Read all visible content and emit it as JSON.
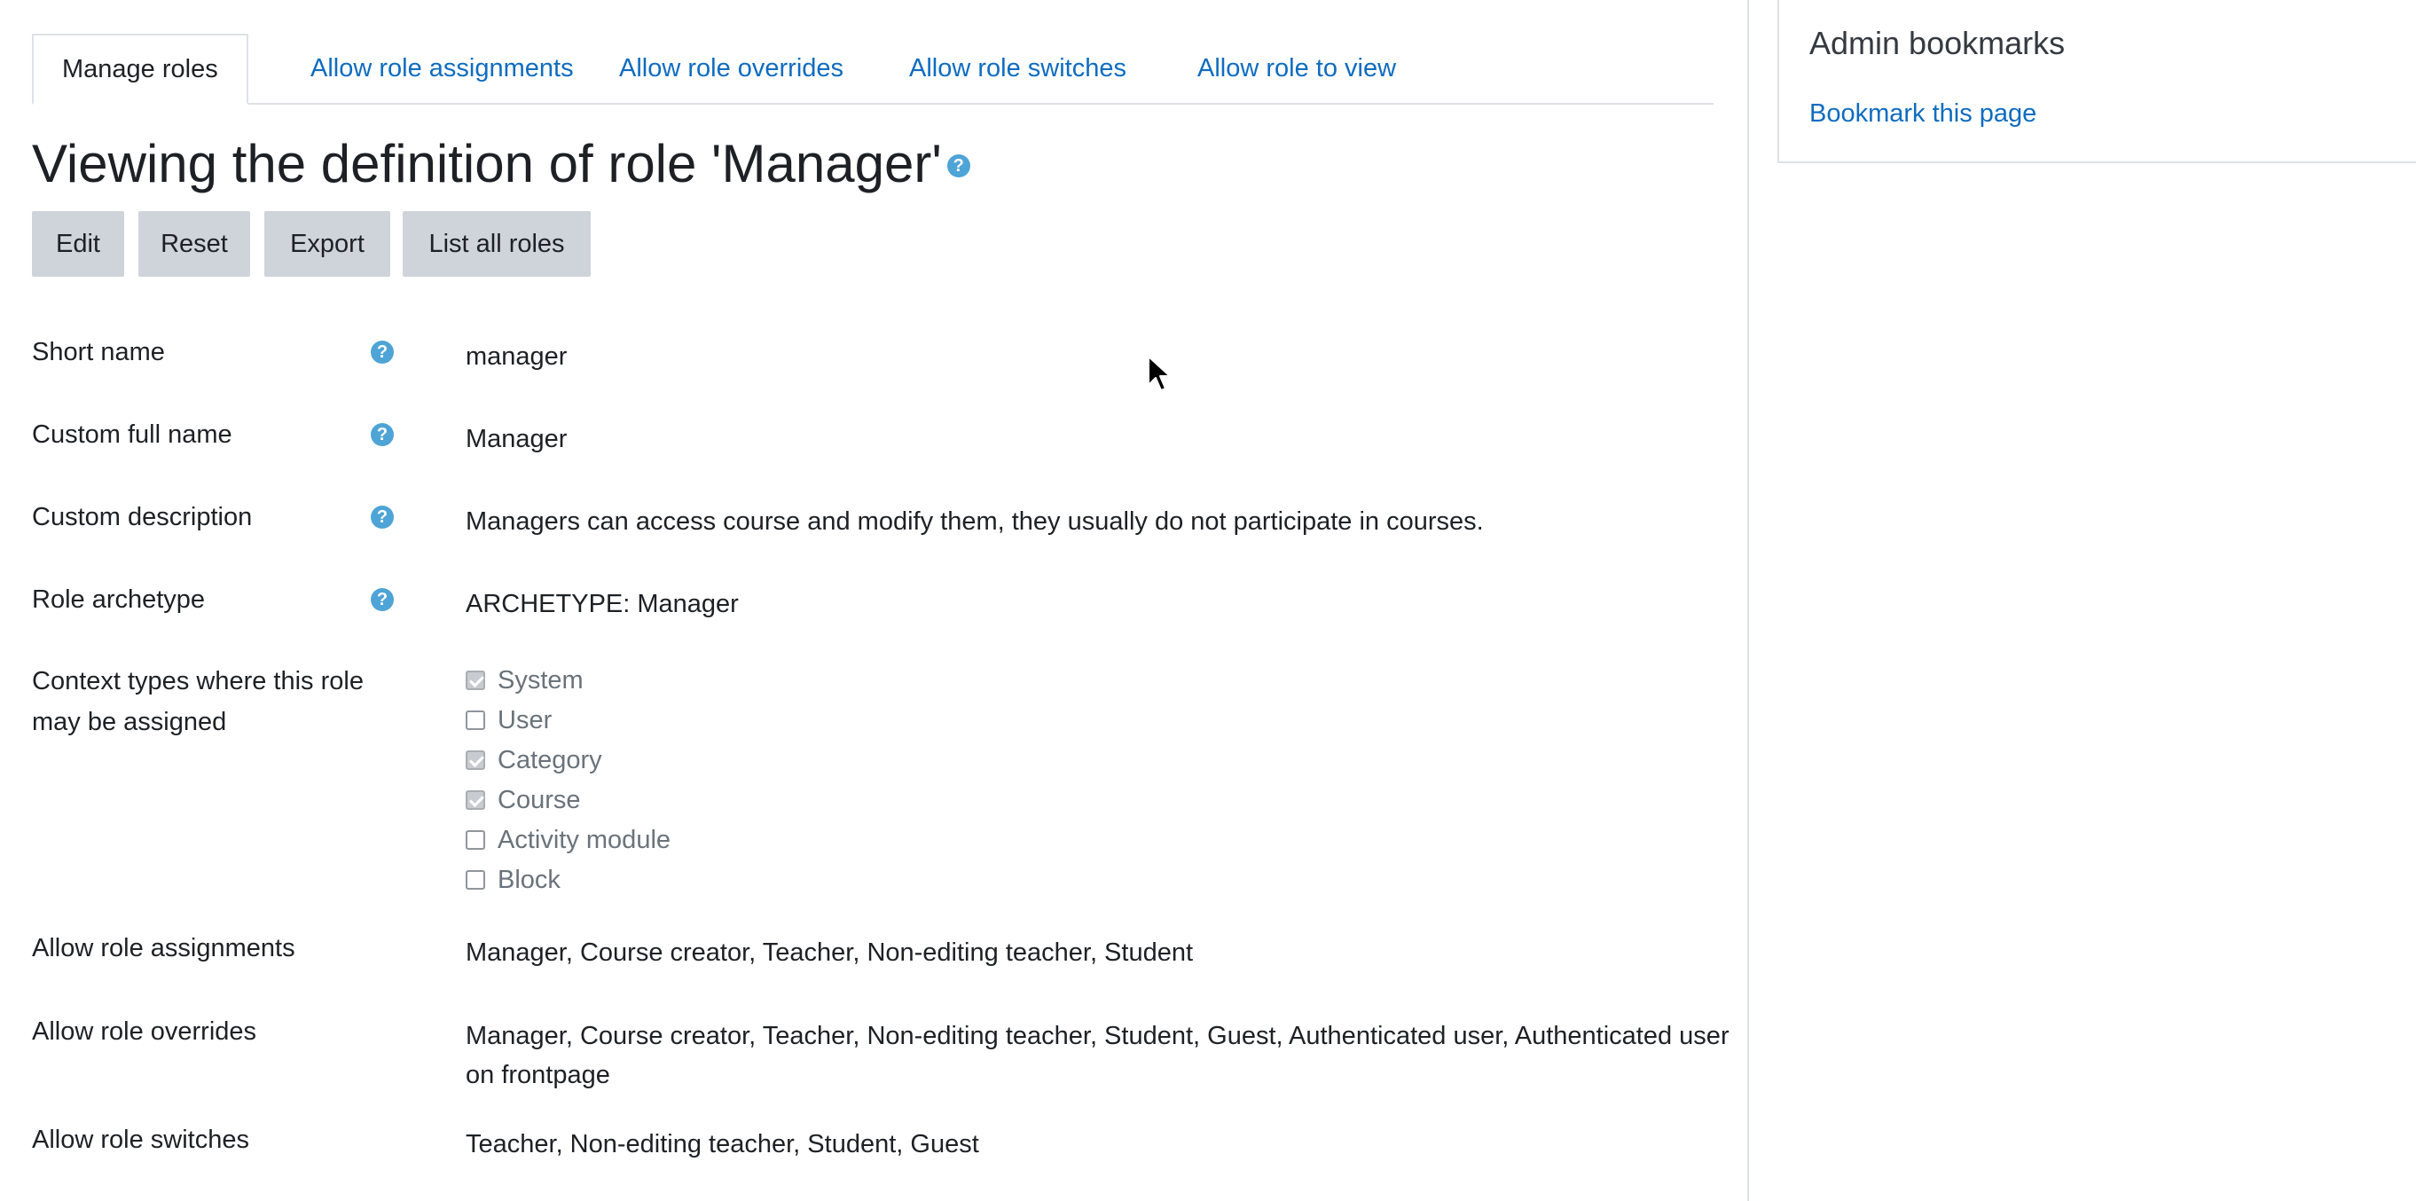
{
  "tabs": [
    {
      "label": "Manage roles",
      "active": true
    },
    {
      "label": "Allow role assignments"
    },
    {
      "label": "Allow role overrides"
    },
    {
      "label": "Allow role switches"
    },
    {
      "label": "Allow role to view"
    }
  ],
  "page": {
    "heading": "Viewing the definition of role 'Manager'",
    "help_glyph": "?"
  },
  "toolbar": {
    "edit_label": "Edit",
    "reset_label": "Reset",
    "export_label": "Export",
    "list_all_label": "List all roles"
  },
  "fields": {
    "short_name": {
      "label": "Short name",
      "value": "manager"
    },
    "full_name": {
      "label": "Custom full name",
      "value": "Manager"
    },
    "description": {
      "label": "Custom description",
      "value": "Managers can access course and modify them, they usually do not participate in courses."
    },
    "archetype": {
      "label": "Role archetype",
      "value": "ARCHETYPE: Manager"
    },
    "context_types": {
      "label": "Context types where this role may be assigned",
      "options": [
        {
          "label": "System",
          "checked": true
        },
        {
          "label": "User",
          "checked": false
        },
        {
          "label": "Category",
          "checked": true
        },
        {
          "label": "Course",
          "checked": true
        },
        {
          "label": "Activity module",
          "checked": false
        },
        {
          "label": "Block",
          "checked": false
        }
      ]
    },
    "allow_assign": {
      "label": "Allow role assignments",
      "value": "Manager, Course creator, Teacher, Non-editing teacher, Student"
    },
    "allow_override": {
      "label": "Allow role overrides",
      "value": "Manager, Course creator, Teacher, Non-editing teacher, Student, Guest, Authenticated user, Authenticated user on frontpage"
    },
    "allow_switch": {
      "label": "Allow role switches",
      "value": "Teacher, Non-editing teacher, Student, Guest"
    }
  },
  "sidebar": {
    "block_title": "Admin bookmarks",
    "bookmark_link": "Bookmark this page"
  },
  "colors": {
    "link": "#0f6cbf",
    "button_bg": "#ced4da",
    "help_icon": "#4ea4d6"
  }
}
